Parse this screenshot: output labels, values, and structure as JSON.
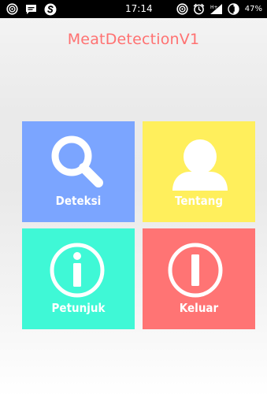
{
  "status_bar": {
    "time": "17:14",
    "battery_percent": "47%",
    "left_icons": [
      "nfc-icon",
      "message-icon",
      "app-s-icon"
    ],
    "right_icons": [
      "nfc-icon",
      "alarm-icon",
      "signal-icon",
      "battery-icon"
    ]
  },
  "app": {
    "title": "MeatDetectionV1"
  },
  "tiles": [
    {
      "label": "Deteksi",
      "icon": "search-icon",
      "color": "#7ba5ff"
    },
    {
      "label": "Tentang",
      "icon": "user-icon",
      "color": "#ffef5c"
    },
    {
      "label": "Petunjuk",
      "icon": "info-icon",
      "color": "#3ff8d6"
    },
    {
      "label": "Keluar",
      "icon": "exit-icon",
      "color": "#ff7474"
    }
  ],
  "colors": {
    "title": "#ff7171",
    "status_bar_bg": "#000000"
  }
}
